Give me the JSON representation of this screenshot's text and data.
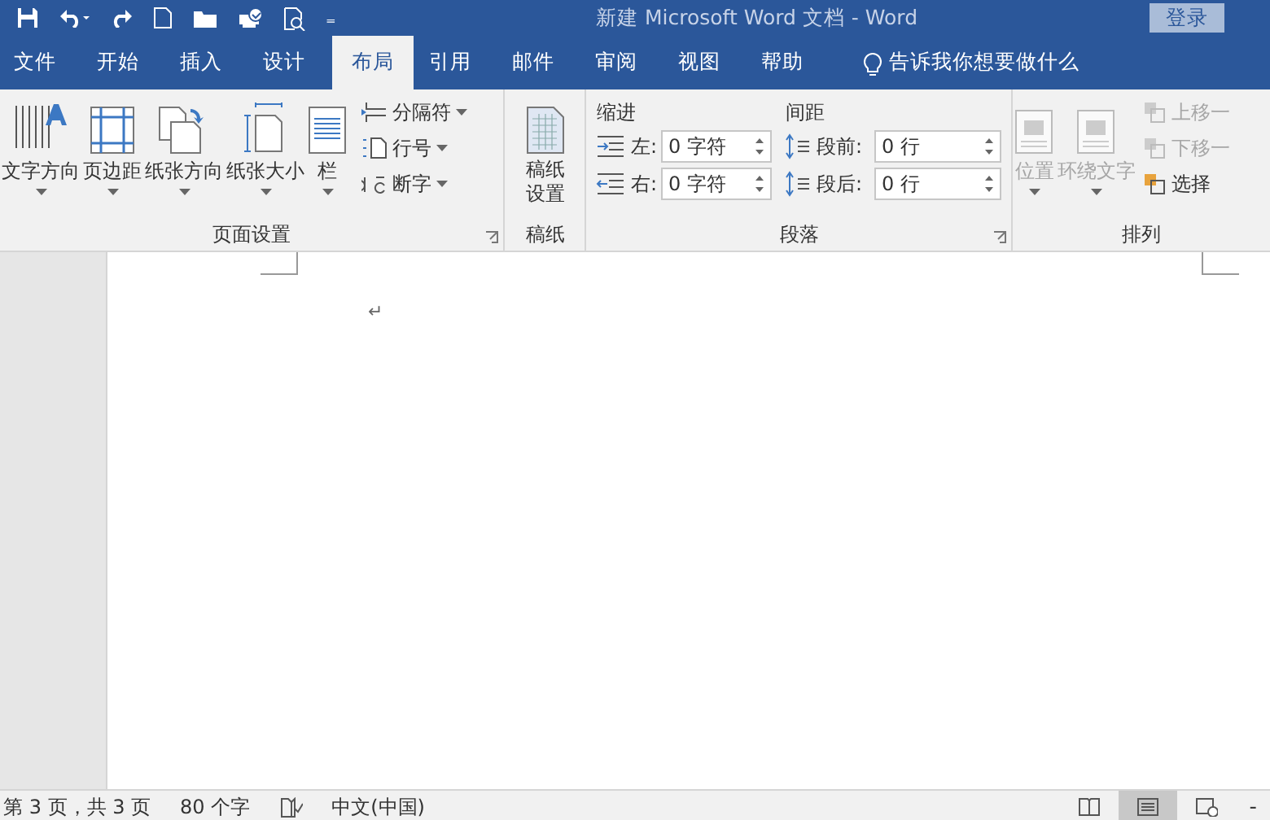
{
  "window": {
    "title": "新建 Microsoft Word 文档  -  Word",
    "login": "登录"
  },
  "quick_access": {
    "more": "₌"
  },
  "tabs": [
    {
      "label": "文件",
      "selected": false
    },
    {
      "label": "开始",
      "selected": false
    },
    {
      "label": "插入",
      "selected": false
    },
    {
      "label": "设计",
      "selected": false
    },
    {
      "label": "布局",
      "selected": true
    },
    {
      "label": "引用",
      "selected": false
    },
    {
      "label": "邮件",
      "selected": false
    },
    {
      "label": "审阅",
      "selected": false
    },
    {
      "label": "视图",
      "selected": false
    },
    {
      "label": "帮助",
      "selected": false
    }
  ],
  "tell_me": "告诉我你想要做什么",
  "ribbon": {
    "page_setup": {
      "label": "页面设置",
      "big": [
        {
          "label": "文字方向",
          "kind": "textdir"
        },
        {
          "label": "页边距",
          "kind": "margins"
        },
        {
          "label": "纸张方向",
          "kind": "orient"
        },
        {
          "label": "纸张大小",
          "kind": "size"
        },
        {
          "label": "栏",
          "kind": "columns"
        }
      ],
      "small": [
        {
          "label": "分隔符",
          "kind": "breaks"
        },
        {
          "label": "行号",
          "kind": "linenum"
        },
        {
          "label": "断字",
          "kind": "hyphen"
        }
      ]
    },
    "draft": {
      "label": "稿纸",
      "button": "稿纸设置"
    },
    "paragraph": {
      "label": "段落",
      "indent": {
        "title": "缩进",
        "fields": [
          {
            "label": "左:",
            "value": "0 字符"
          },
          {
            "label": "右:",
            "value": "0 字符"
          }
        ]
      },
      "spacing": {
        "title": "间距",
        "fields": [
          {
            "label": "段前:",
            "value": "0 行"
          },
          {
            "label": "段后:",
            "value": "0 行"
          }
        ]
      }
    },
    "arrange": {
      "label": "排列",
      "big": [
        {
          "label": "位置",
          "disabled": true
        },
        {
          "label": "环绕文字",
          "disabled": true
        }
      ],
      "small": [
        {
          "label": "上移一",
          "disabled": true
        },
        {
          "label": "下移一",
          "disabled": true
        },
        {
          "label": "选择",
          "disabled": false
        }
      ]
    }
  },
  "document": {
    "paragraph_mark": "↵"
  },
  "status_bar": {
    "page": "第 3 页，共 3 页",
    "words": "80 个字",
    "language": "中文(中国)",
    "views": [
      {
        "kind": "read",
        "selected": false
      },
      {
        "kind": "print",
        "selected": true
      },
      {
        "kind": "web",
        "selected": false
      }
    ],
    "zoom_out": "-"
  }
}
